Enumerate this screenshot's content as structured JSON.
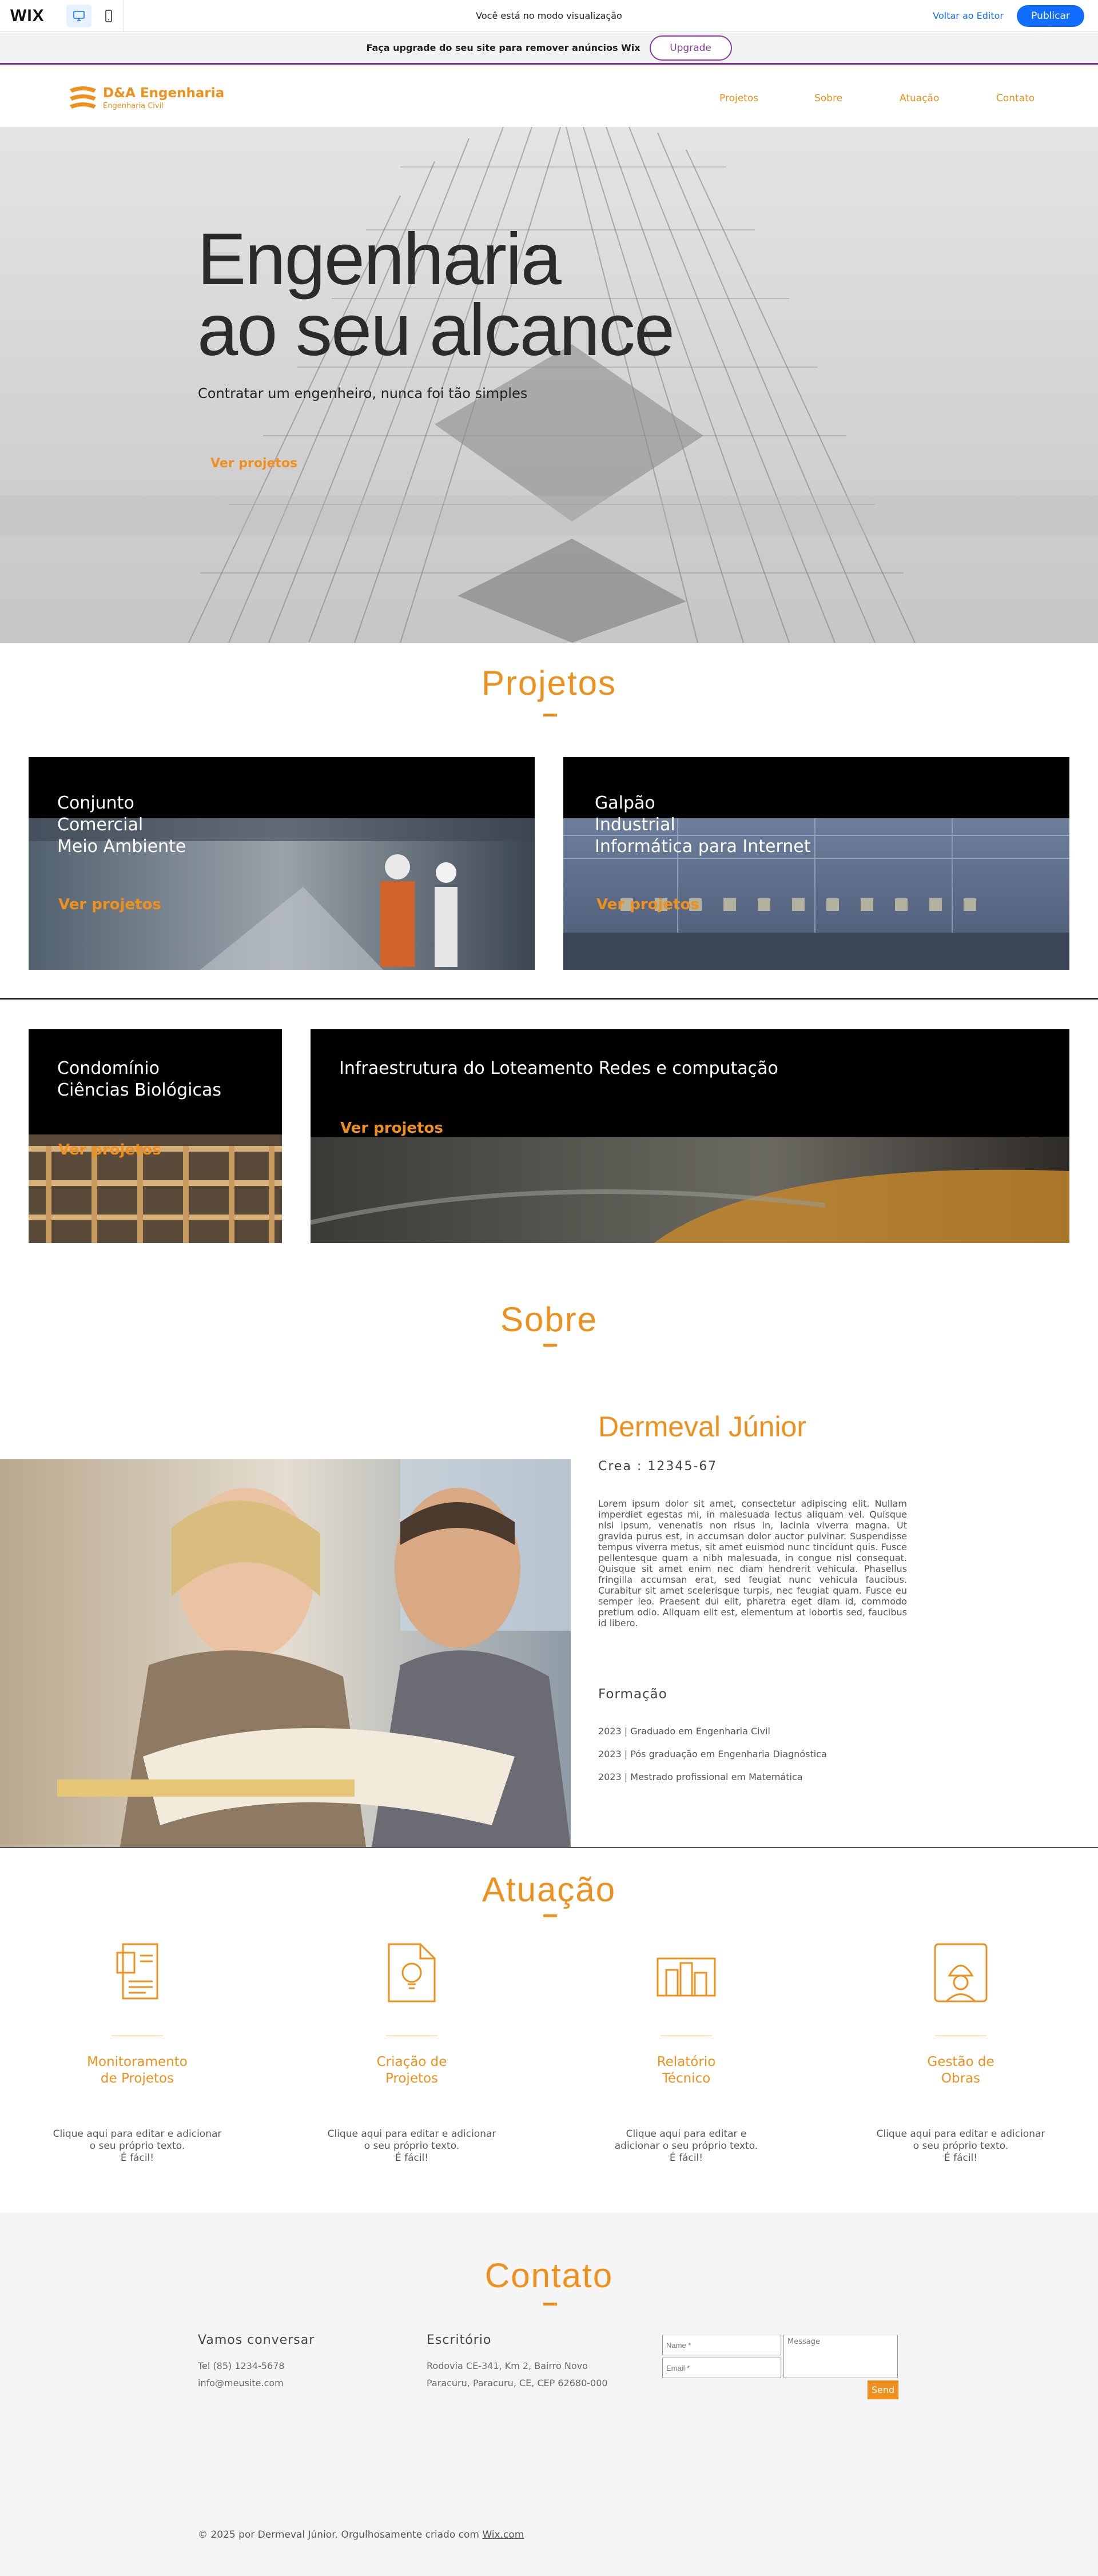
{
  "wix_bar": {
    "logo": "WIX",
    "viewing_text": "Você está no modo visualização",
    "back_link": "Voltar ao Editor",
    "publish_label": "Publicar"
  },
  "upgrade_bar": {
    "text": "Faça upgrade do seu site para remover anúncios Wix",
    "button": "Upgrade",
    "accent_color": "#7a2b8c"
  },
  "site": {
    "brand": "D&A Engenharia",
    "brand_sub": "Engenharia Civil",
    "accent_color": "#f0901c",
    "nav": [
      "Projetos",
      "Sobre",
      "Atuação",
      "Contato"
    ]
  },
  "hero": {
    "title_line1": "Engenharia",
    "title_line2": "ao seu alcance",
    "subtitle": "Contratar um engenheiro, nunca foi tão simples",
    "cta": "Ver projetos"
  },
  "projects": {
    "title": "Projetos",
    "cards": [
      {
        "title": [
          "Conjunto",
          "Comercial",
          "Meio Ambiente"
        ],
        "cta": "Ver projetos"
      },
      {
        "title": [
          "Galpão",
          "Industrial",
          "Informática para Internet"
        ],
        "cta": "Ver projetos"
      },
      {
        "title": [
          "Condomínio",
          "Ciências Biológicas"
        ],
        "cta": "Ver projetos"
      },
      {
        "title": [
          "Infraestrutura do Loteamento Redes e computação"
        ],
        "cta": "Ver projetos"
      }
    ]
  },
  "about": {
    "title": "Sobre",
    "name": "Dermeval Júnior",
    "crea": "Crea : 12345-67",
    "bio": "Lorem ipsum dolor sit amet, consectetur adipiscing elit. Nullam imperdiet egestas mi, in malesuada lectus aliquam vel. Quisque nisi ipsum, venenatis non risus in, lacinia viverra magna. Ut gravida purus est, in accumsan dolor auctor pulvinar. Suspendisse tempus viverra metus, sit amet euismod nunc tincidunt quis. Fusce pellentesque quam a nibh malesuada, in congue nisl consequat. Quisque sit amet enim nec diam hendrerit vehicula. Phasellus fringilla accumsan erat, sed feugiat nunc vehicula faucibus. Curabitur sit amet scelerisque turpis, nec feugiat quam. Fusce eu semper leo. Praesent dui elit, pharetra eget diam id, commodo pretium odio. Aliquam elit est, elementum at lobortis sed, faucibus id libero.",
    "formation_title": "Formação",
    "formation": [
      "2023 | Graduado em Engenharia Civil",
      "2023 | Pós graduação em Engenharia Diagnóstica",
      "2023 | Mestrado profissional em Matemática"
    ]
  },
  "services": {
    "title": "Atuação",
    "items": [
      {
        "icon": "report-icon",
        "title": [
          "Monitoramento",
          "de Projetos"
        ],
        "desc": [
          "Clique aqui para editar e adicionar",
          "o seu próprio texto.",
          "É fácil!"
        ]
      },
      {
        "icon": "idea-document-icon",
        "title": [
          "Criação de",
          "Projetos"
        ],
        "desc": [
          "Clique aqui para editar e adicionar",
          "o seu próprio texto.",
          "É fácil!"
        ]
      },
      {
        "icon": "building-plan-icon",
        "title": [
          "Relatório",
          "Técnico"
        ],
        "desc": [
          "Clique aqui para editar e",
          "adicionar o seu próprio texto.",
          "É fácil!"
        ]
      },
      {
        "icon": "engineer-blueprint-icon",
        "title": [
          "Gestão de",
          "Obras"
        ],
        "desc": [
          "Clique aqui para editar e adicionar",
          "o seu próprio texto.",
          "É fácil!"
        ]
      }
    ]
  },
  "contact": {
    "title": "Contato",
    "col1_title": "Vamos conversar",
    "phone": "Tel (85) 1234-5678",
    "email": "info@meusite.com",
    "col2_title": "Escritório",
    "address1": "Rodovia CE-341, Km 2, Bairro Novo",
    "address2": "Paracuru, Paracuru, CE, CEP 62680-000",
    "name_placeholder": "Name *",
    "email_placeholder": "Email *",
    "message_placeholder": "Message",
    "send": "Send"
  },
  "footer": {
    "text": "© 2025 por Dermeval Júnior. Orgulhosamente criado com ",
    "link": "Wix.com"
  }
}
